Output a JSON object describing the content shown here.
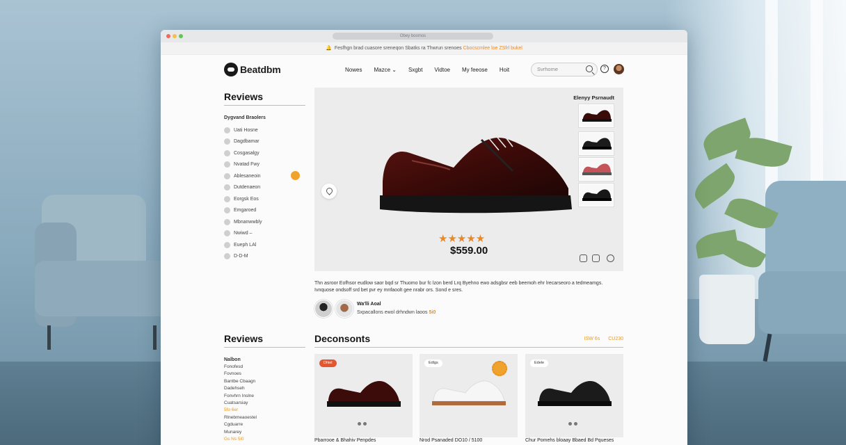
{
  "browser": {
    "url": "Obey boomos"
  },
  "announcement": {
    "text": "Fesfhgn brad cuasore sreneqon Sbatks ra Thwrun srenoes",
    "accent": "Cbocscmlee loe ZSfrl bukel"
  },
  "brand": {
    "name": "Beatdbm"
  },
  "nav": {
    "links": [
      "Nowes",
      "Mazce",
      "Sxgbt",
      "Vidtoe",
      "My feeose",
      "Hoit"
    ]
  },
  "search": {
    "placeholder": "Svrhome"
  },
  "sidebar": {
    "title": "Reviews",
    "subtitle": "Dygvand Braolers",
    "items": [
      "Uati Hosne",
      "Dagdbamar",
      "Cosgasalgy",
      "Nvatad Fwy",
      "Ablesaneoin",
      "Dutdenaeon",
      "Eorgsk Eos",
      "Emgaroed",
      "Mbnanwwbly",
      "Nwiwd –",
      "Eueph LAl",
      "D-D-M"
    ]
  },
  "hero": {
    "thumbs_title": "Elenyy Psrnaudt",
    "rating": 5,
    "stars": "★★★★★",
    "price": "$559.00"
  },
  "description": {
    "line1": "Thn asroor Eofhsor eudlow saor bqd sr Thuomo bur fc lzon berd Lrq Byehno ewo adsgbsr eeb beemoh ehr lrecarseoro a tedmeamgs.",
    "line2": "Ivnquose ondsoff srd bet pvr ey mnfaoolt gee nrabr ors. Sond e sres."
  },
  "review_snippet": {
    "name": "Wa'lli Aoal",
    "text": "Sxpacallons ewol drhndwn laoos",
    "accent": "5i0"
  },
  "lower_sidebar": {
    "title": "Reviews",
    "subtitle": "Nalbon",
    "items": [
      "Fonofesd",
      "Fovnoes",
      "Bantbe Cbaagn",
      "Dadehseh",
      "Fonvhrn Inslne",
      "Cuatsarsiay",
      "5fo 6er",
      "Rlnebmeaoestel",
      "Cgduarre",
      "Munarey",
      "Gs Ns 5i0"
    ],
    "accent_indexes": [
      6,
      10
    ]
  },
  "discounts": {
    "title": "Deconsonts",
    "links": [
      "ISW 6s",
      "CU230"
    ],
    "cards": [
      {
        "tag": "Dhiel",
        "title": "Pbarrooe & Bhahiv Penpdes"
      },
      {
        "tag": "Edlgs",
        "title": "Nrod Psanaded DO10 / 5100"
      },
      {
        "tag": "Edele",
        "title": "Chur Pomehs bloaay Bbaed Bd Pqueses"
      }
    ]
  },
  "colors": {
    "accent": "#e98b2c",
    "badge": "#f0a32c",
    "dark": "#151515"
  },
  "icons": [
    "search-icon",
    "help-icon",
    "location-pin-icon",
    "bag-icon",
    "share-icon",
    "heart-icon"
  ]
}
